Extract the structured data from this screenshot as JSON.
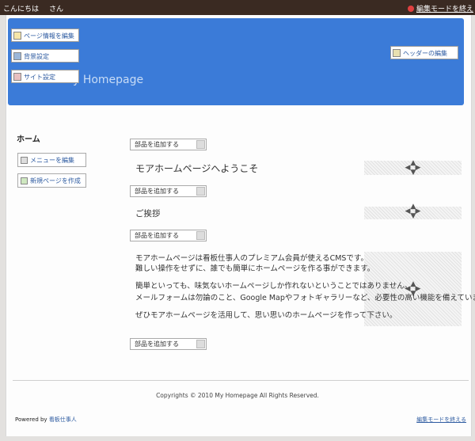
{
  "topbar": {
    "greeting": "こんにちは",
    "user_suffix": "さん",
    "edit_mode_link": "編集モードを終え"
  },
  "header": {
    "site_title": "My Homepage",
    "buttons": {
      "page_info": "ページ情報を編集",
      "background": "背景設定",
      "site_settings": "サイト設定",
      "header_edit": "ヘッダーの編集"
    }
  },
  "sidebar": {
    "title": "ホーム",
    "menu_edit": "メニューを編集",
    "new_page": "新規ページを作成"
  },
  "main": {
    "add_part_label": "部品を追加する",
    "welcome_title": "モアホームページへようこそ",
    "greeting_title": "ご挨拶",
    "paragraphs": [
      "モアホームページは看板仕事人のプレミアム会員が使えるCMSです。",
      "難しい操作をせずに、誰でも簡単にホームページを作る事ができます。",
      "簡単といっても、味気ないホームページしか作れないということではありません。",
      "メールフォームは勿論のこと、Google Mapやフォトギャラリーなど、必要性の高い機能を備えています。",
      "ぜひモアホームページを活用して、思い思いのホームページを作って下さい。"
    ]
  },
  "footer": {
    "copyright": "Copyrights © 2010 My Homepage All Rights Reserved.",
    "powered_prefix": "Powered by",
    "powered_link": "看板仕事人",
    "edit_mode_link": "編集モードを終える"
  },
  "colors": {
    "header_bg": "#3b7bd8",
    "topbar_bg": "#3a2a22",
    "link": "#2c5aa0"
  }
}
